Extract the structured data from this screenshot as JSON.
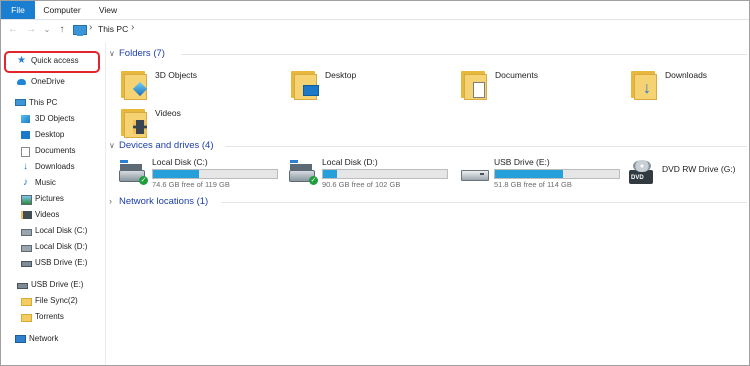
{
  "ribbon": {
    "tabs": [
      "File",
      "Computer",
      "View"
    ]
  },
  "nav_buttons": {
    "back": "←",
    "forward": "→",
    "dropdown": "⌄",
    "up": "↑"
  },
  "address": {
    "separator_1": "›",
    "location": "This PC",
    "separator_2": "›"
  },
  "sidebar": {
    "quick_access": "Quick access",
    "onedrive": "OneDrive",
    "this_pc": "This PC",
    "pc_items": [
      "3D Objects",
      "Desktop",
      "Documents",
      "Downloads",
      "Music",
      "Pictures",
      "Videos",
      "Local Disk (C:)",
      "Local Disk (D:)",
      "USB Drive (E:)"
    ],
    "usb_drive": "USB Drive (E:)",
    "usb_items": [
      "File Sync(2)",
      "Torrents"
    ],
    "network": "Network"
  },
  "content": {
    "folders_header": "Folders (7)",
    "folders": [
      "3D Objects",
      "Desktop",
      "Documents",
      "Downloads",
      "Videos"
    ],
    "devices_header": "Devices and drives (4)",
    "drives": [
      {
        "name": "Local Disk (C:)",
        "free": "74.6 GB free of 119 GB",
        "used_fraction": 0.37
      },
      {
        "name": "Local Disk (D:)",
        "free": "90.6 GB free of 102 GB",
        "used_fraction": 0.11
      },
      {
        "name": "USB Drive (E:)",
        "free": "51.8 GB free of 114 GB",
        "used_fraction": 0.55
      },
      {
        "name": "DVD RW Drive (G:)",
        "free": "",
        "used_fraction": null
      }
    ],
    "dvd_badge": "DVD",
    "network_header": "Network locations (1)"
  },
  "colors": {
    "accent": "#1a7fd0",
    "group_heading": "#1c3ea8",
    "drive_fill": "#26a0da",
    "highlight_ring": "#e2252c"
  }
}
